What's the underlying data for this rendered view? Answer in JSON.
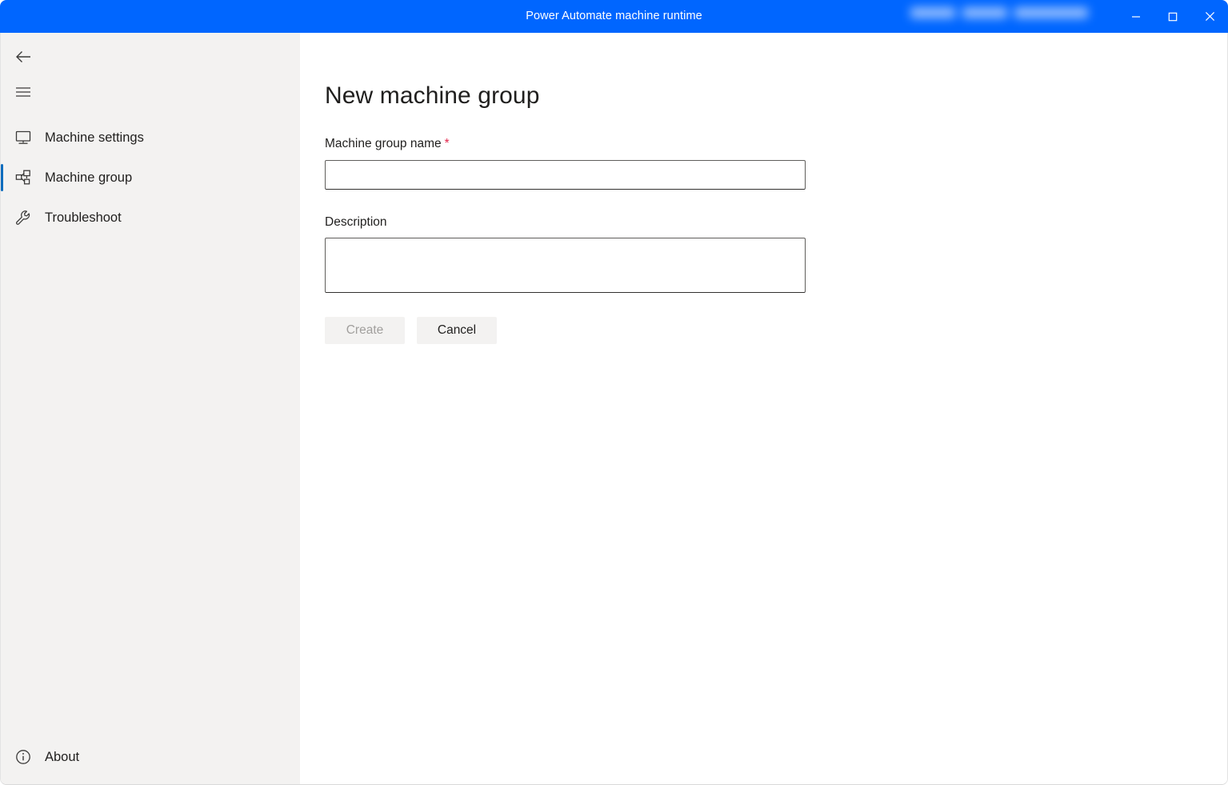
{
  "window": {
    "title": "Power Automate machine runtime",
    "redacted_account_text": "",
    "controls": {
      "minimize_label": "Minimize",
      "maximize_label": "Maximize",
      "close_label": "Close"
    }
  },
  "sidebar": {
    "back_label": "Back",
    "back_icon": "arrow-left-icon",
    "menu_label": "Navigation menu",
    "menu_icon": "hamburger-menu-icon",
    "items": [
      {
        "label": "Machine settings",
        "icon": "monitor-icon",
        "selected": false
      },
      {
        "label": "Machine group",
        "icon": "machine-group-icon",
        "selected": true
      },
      {
        "label": "Troubleshoot",
        "icon": "wrench-icon",
        "selected": false
      }
    ],
    "bottom": {
      "label": "About",
      "icon": "info-circle-icon"
    },
    "selection_color": "#0f6cbd",
    "background_color": "#f3f2f1"
  },
  "main": {
    "page_title": "New machine group",
    "fields": [
      {
        "label": "Machine group name",
        "required": true,
        "required_marker": "*",
        "value": "",
        "placeholder": ""
      },
      {
        "label": "Description",
        "required": false,
        "required_marker": "",
        "value": "",
        "placeholder": ""
      }
    ],
    "buttons": {
      "create_label": "Create",
      "create_disabled": true,
      "cancel_label": "Cancel",
      "cancel_disabled": false
    },
    "required_color": "#e3264c"
  },
  "theme": {
    "titlebar_color": "#0066ff",
    "titlebar_text_color": "#ffffff",
    "content_background": "#ffffff",
    "text_color": "#201f1e"
  }
}
